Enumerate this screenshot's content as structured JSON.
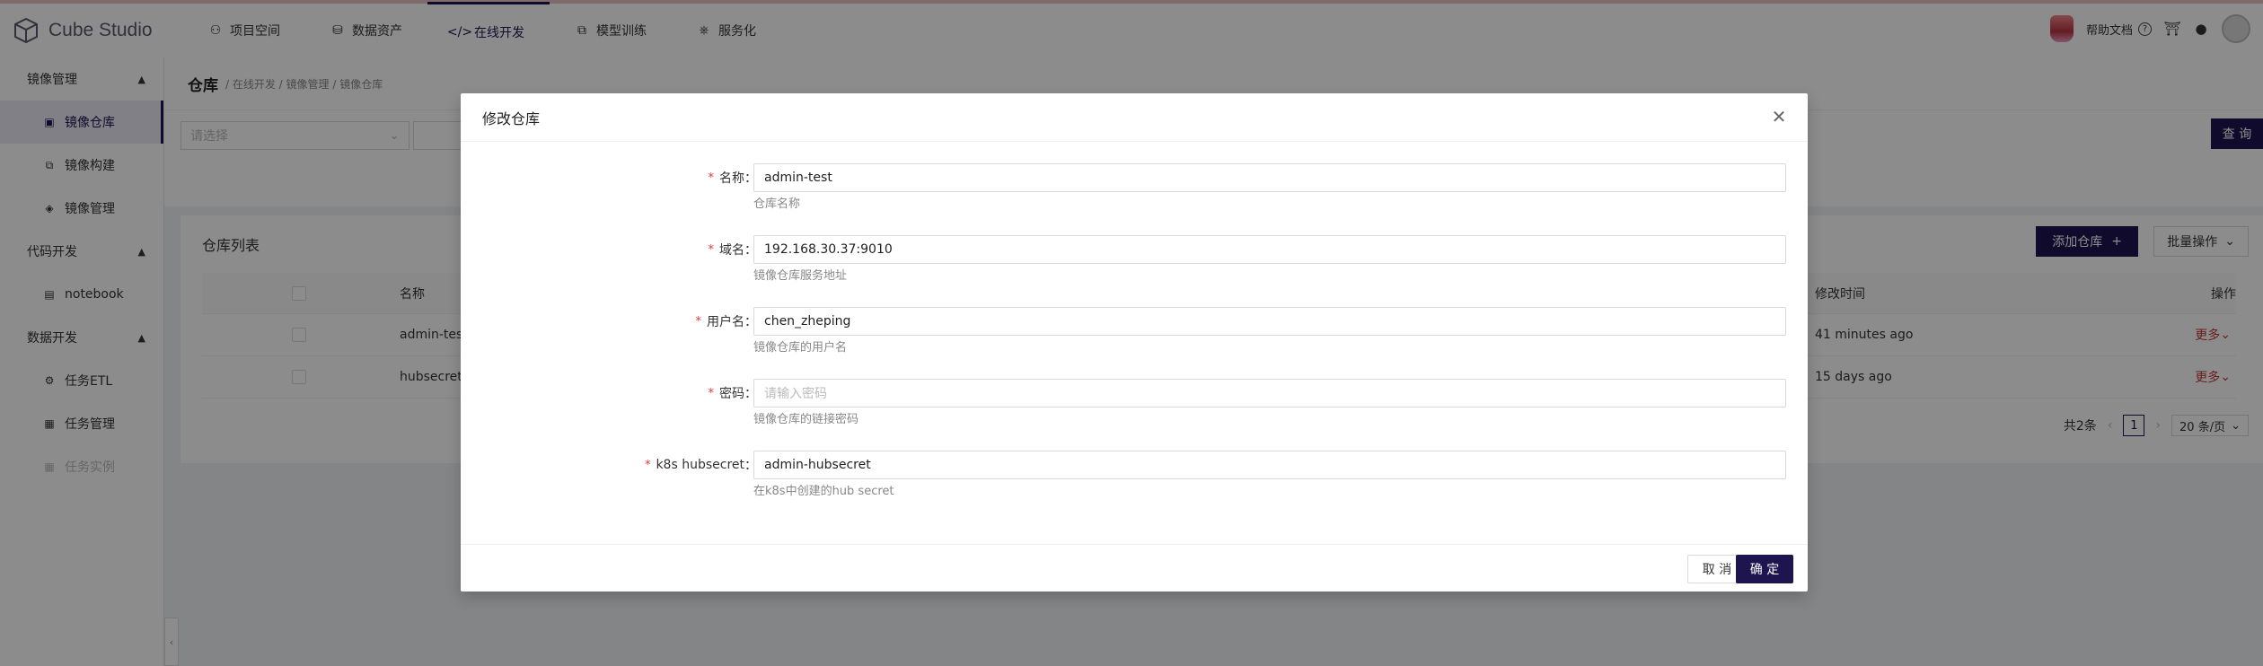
{
  "header": {
    "app_name": "Cube Studio",
    "nav": [
      {
        "label": "项目空间",
        "icon": "users-icon"
      },
      {
        "label": "数据资产",
        "icon": "database-icon"
      },
      {
        "label": "在线开发",
        "icon": "code-icon"
      },
      {
        "label": "模型训练",
        "icon": "layers-icon"
      },
      {
        "label": "服务化",
        "icon": "service-icon"
      }
    ],
    "help_label": "帮助文档"
  },
  "sidebar": {
    "groups": [
      {
        "label": "镜像管理",
        "items": [
          "镜像仓库",
          "镜像构建",
          "镜像管理"
        ]
      },
      {
        "label": "代码开发",
        "items": [
          "notebook"
        ]
      },
      {
        "label": "数据开发",
        "items": [
          "任务ETL",
          "任务管理",
          "任务实例"
        ]
      }
    ]
  },
  "page": {
    "title": "仓库",
    "breadcrumb": "/ 在线开发 / 镜像管理 / 镜像仓库",
    "filter_placeholder": "请选择",
    "query_label": "查 询",
    "list_title": "仓库列表",
    "add_label": "添加仓库",
    "batch_label": "批量操作",
    "table": {
      "columns": [
        "名称",
        "修改时间",
        "操作"
      ],
      "rows": [
        {
          "name": "admin-test",
          "modified": "41 minutes ago",
          "action": "更多"
        },
        {
          "name": "hubsecret",
          "modified": "15 days ago",
          "action": "更多"
        }
      ]
    },
    "pager": {
      "total": "共2条",
      "current": "1",
      "size": "20 条/页"
    }
  },
  "modal": {
    "title": "修改仓库",
    "fields": [
      {
        "label": "名称",
        "value": "admin-test",
        "placeholder": "",
        "help": "仓库名称"
      },
      {
        "label": "域名",
        "value": "192.168.30.37:9010",
        "placeholder": "",
        "help": "镜像仓库服务地址"
      },
      {
        "label": "用户名",
        "value": "chen_zheping",
        "placeholder": "",
        "help": "镜像仓库的用户名"
      },
      {
        "label": "密码",
        "value": "",
        "placeholder": "请输入密码",
        "help": "镜像仓库的链接密码"
      },
      {
        "label": "k8s hubsecret",
        "value": "admin-hubsecret",
        "placeholder": "",
        "help": "在k8s中创建的hub secret"
      }
    ],
    "cancel_label": "取 消",
    "ok_label": "确 定"
  },
  "colors": {
    "primary": "#1e1450",
    "danger": "#c0392b",
    "required": "#e33333"
  }
}
